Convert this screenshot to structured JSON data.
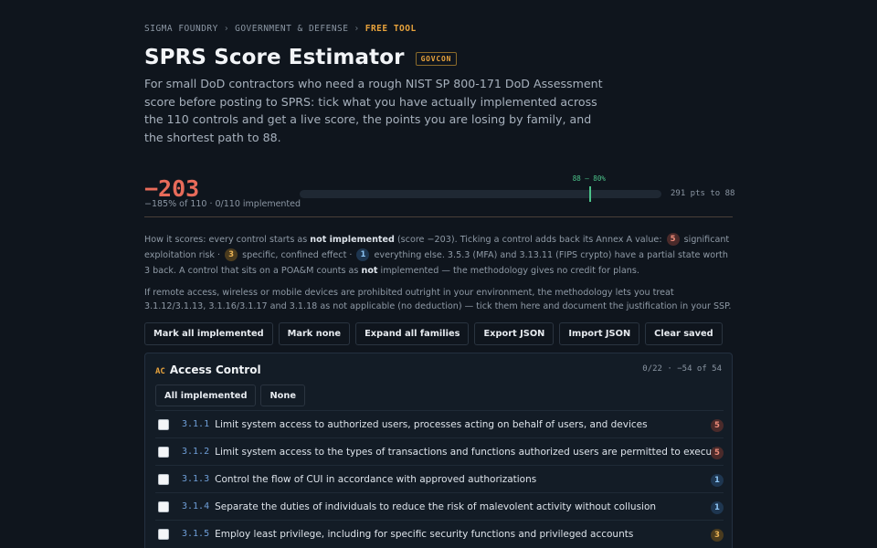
{
  "breadcrumb": {
    "items": [
      "SIGMA FOUNDRY",
      "GOVERNMENT & DEFENSE",
      "FREE TOOL"
    ],
    "separator": "›"
  },
  "header": {
    "title": "SPRS Score Estimator",
    "tag": "GOVCON",
    "intro": "For small DoD contractors who need a rough NIST SP 800-171 DoD Assessment score before posting to SPRS: tick what you have actually implemented across the 110 controls and get a live score, the points you are losing by family, and the shortest path to 88."
  },
  "score": {
    "value": "−203",
    "subtitle": "−185% of 110 · 0/110 implemented",
    "progress": 0,
    "marker_label": "88 – 80%",
    "marker_fraction": 0.8,
    "to_go": "291 pts to 88"
  },
  "how_it_scores": {
    "p1": "How it scores: every control starts as ",
    "b1": "not implemented",
    "p2": " (score −203). Ticking a control adds back its Annex A value: ",
    "pill5": "5",
    "p3": " significant exploitation risk · ",
    "pill3": "3",
    "p4": " specific, confined effect · ",
    "pill1": "1",
    "p5": " everything else. 3.5.3 (MFA) and 3.13.11 (FIPS crypto) have a partial state worth 3 back. A control that sits on a POA&M counts as ",
    "b2": "not",
    "p6": " implemented — the methodology gives no credit for plans."
  },
  "note": "If remote access, wireless or mobile devices are prohibited outright in your environment, the methodology lets you treat 3.1.12/3.1.13, 3.1.16/3.1.17 and 3.1.18 as not applicable (no deduction) — tick them here and document the justification in your SSP.",
  "actions": {
    "mark_all": "Mark all implemented",
    "mark_none": "Mark none",
    "expand": "Expand all families",
    "export": "Export JSON",
    "import": "Import JSON",
    "clear": "Clear saved"
  },
  "family": {
    "code": "AC",
    "name": "Access Control",
    "stats": "0/22 · −54 of 54",
    "all_label": "All implemented",
    "none_label": "None",
    "controls": [
      {
        "id": "3.1.1",
        "text": "Limit system access to authorized users, processes acting on behalf of users, and devices",
        "points": "5"
      },
      {
        "id": "3.1.2",
        "text": "Limit system access to the types of transactions and functions authorized users are permitted to execute",
        "points": "5"
      },
      {
        "id": "3.1.3",
        "text": "Control the flow of CUI in accordance with approved authorizations",
        "points": "1"
      },
      {
        "id": "3.1.4",
        "text": "Separate the duties of individuals to reduce the risk of malevolent activity without collusion",
        "points": "1"
      },
      {
        "id": "3.1.5",
        "text": "Employ least privilege, including for specific security functions and privileged accounts",
        "points": "3"
      }
    ]
  },
  "colors": {
    "background": "#0f151d",
    "accent": "#e8a33c",
    "score_negative": "#e86b5a",
    "target_marker": "#4cc38a",
    "control_id": "#6f9fd8"
  }
}
